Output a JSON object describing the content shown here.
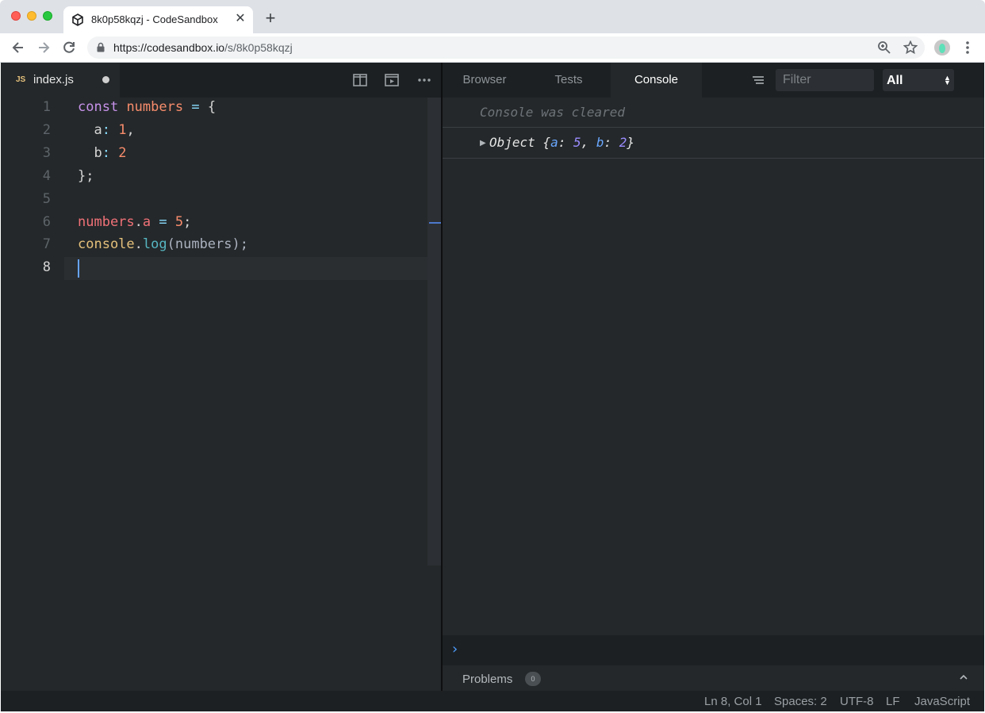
{
  "browser": {
    "tab_title": "8k0p58kqzj - CodeSandbox",
    "url_host": "https://codesandbox.io",
    "url_path": "/s/8k0p58kqzj",
    "new_tab_label": "+",
    "close_label": "✕"
  },
  "editor": {
    "file_badge": "JS",
    "file_name": "index.js",
    "line_numbers": [
      "1",
      "2",
      "3",
      "4",
      "5",
      "6",
      "7",
      "8"
    ],
    "code": {
      "l1_kw": "const",
      "l1_var": "numbers",
      "l1_op": "=",
      "l1_brace": "{",
      "l2_key": "a",
      "l2_colon": ":",
      "l2_val": "1",
      "l2_comma": ",",
      "l3_key": "b",
      "l3_colon": ":",
      "l3_val": "2",
      "l4_close": "};",
      "l6_obj": "numbers",
      "l6_dot": ".",
      "l6_prop": "a",
      "l6_op": "=",
      "l6_val": "5",
      "l6_semi": ";",
      "l7_obj": "console",
      "l7_dot": ".",
      "l7_fn": "log",
      "l7_args": "(numbers);"
    }
  },
  "preview": {
    "tabs": [
      "Browser",
      "Tests",
      "Console"
    ],
    "active_tab": "Console",
    "filter_placeholder": "Filter",
    "level_value": "All",
    "cleared_message": "Console was cleared",
    "log_entry": {
      "prefix": "Object {",
      "key_a": "a",
      "val_a": "5",
      "key_b": "b",
      "val_b": "2",
      "sep1": ": ",
      "comma": ", ",
      "sep2": ": ",
      "suffix": "}"
    },
    "prompt_symbol": "›",
    "problems_label": "Problems",
    "problems_count": "0"
  },
  "status_bar": {
    "position": "Ln 8, Col 1",
    "spaces": "Spaces: 2",
    "encoding": "UTF-8",
    "line_ending": "LF",
    "language": "JavaScript"
  },
  "colors": {
    "accent": "#4d9dff",
    "background": "#24282a",
    "keyword": "#c792ea",
    "number": "#f78c6c"
  },
  "icons": [
    "codesandbox-icon",
    "back-icon",
    "forward-icon",
    "reload-icon",
    "lock-icon",
    "zoom-icon",
    "star-icon",
    "profile-icon",
    "menu-dots-icon",
    "split-view-icon",
    "preview-icon",
    "more-icon",
    "wrap-lines-icon",
    "chevron-up-icon"
  ]
}
